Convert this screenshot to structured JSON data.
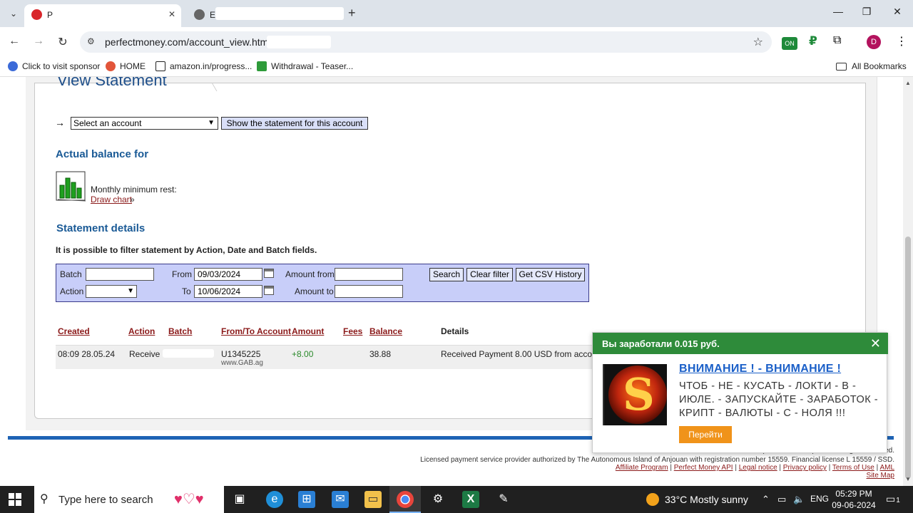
{
  "browser": {
    "tabs": [
      {
        "title": "P",
        "favicon_color": "#d9262b"
      },
      {
        "title": "E",
        "favicon_color": "#555555"
      }
    ],
    "url": "perfectmoney.com/account_view.html?",
    "bookmarks": [
      {
        "label": "Click to visit sponsor",
        "color": "#3b6ad8"
      },
      {
        "label": "HOME",
        "color": "#e2553a"
      },
      {
        "label": "amazon.in/progress...",
        "color": "#222222"
      },
      {
        "label": "Withdrawal - Teaser...",
        "color": "#2e9b3a"
      }
    ],
    "all_bookmarks": "All Bookmarks",
    "avatar_letter": "D",
    "ext_badge": "ON"
  },
  "page": {
    "title": "View Statement",
    "account_select": "Select an account",
    "show_button": "Show the statement for this account",
    "actual_balance": "Actual balance for",
    "monthly_min": "Monthly minimum rest:",
    "draw_chart": "Draw chart",
    "raquo": "»",
    "statement_details": "Statement details",
    "filter_note": "It is possible to filter statement by Action, Date and Batch fields.",
    "filter": {
      "batch_label": "Batch",
      "action_label": "Action",
      "from_label": "From",
      "from_value": "09/03/2024",
      "to_label": "To",
      "to_value": "10/06/2024",
      "amount_from_label": "Amount from",
      "amount_to_label": "Amount to",
      "search_btn": "Search",
      "clear_btn": "Clear filter",
      "csv_btn": "Get CSV History"
    },
    "table": {
      "headers": [
        "Created",
        "Action",
        "Batch",
        "From/To Account",
        "Amount",
        "Fees",
        "Balance",
        "Details"
      ],
      "rows": [
        {
          "created": "08:09 28.05.24",
          "action": "Receive",
          "batch": "",
          "account": "U1345225",
          "account_sub": "www.GAB.ag",
          "amount": "+8.00",
          "fees": "",
          "balance": "38.88",
          "details": "Received Payment 8.00 USD from account"
        }
      ]
    },
    "footer": {
      "copyright": "© 2007-2024 Startup Smart Development. All rights reserved.",
      "license": "Licensed payment service provider authorized by The Autonomous Island of Anjouan with registration number 15559. Financial license L 15559 / SSD.",
      "links": [
        "Affiliate Program",
        "Perfect Money API",
        "Legal notice",
        "Privacy policy",
        "Terms of Use",
        "AML"
      ],
      "sitemap": "Site Map"
    }
  },
  "popup": {
    "header": "Вы заработали 0.015 руб.",
    "headline": "ВНИМАНИЕ ! - ВНИМАНИЕ !",
    "body": "ЧТОБ - НЕ - КУСАТЬ - ЛОКТИ - В - ИЮЛЕ. - ЗАПУСКАЙТЕ - ЗАРАБОТОК - КРИПТ - ВАЛЮТЫ - С - НОЛЯ !!!",
    "button": "Перейти",
    "image_letter": "S"
  },
  "taskbar": {
    "search_placeholder": "Type here to search",
    "weather": "33°C  Mostly sunny",
    "lang": "ENG",
    "time": "05:29 PM",
    "date": "09-06-2024",
    "notif_count": "1"
  }
}
